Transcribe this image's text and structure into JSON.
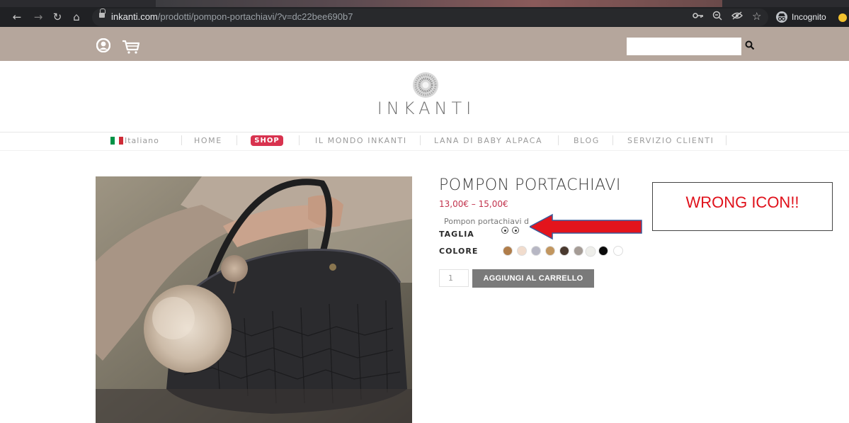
{
  "browser": {
    "url_domain": "inkanti.com",
    "url_path": "/prodotti/pompon-portachiavi/?v=dc22bee690b7",
    "profile_label": "Incognito",
    "icons": [
      "back-icon",
      "forward-icon",
      "reload-icon",
      "home-icon",
      "lock-icon",
      "key-icon",
      "zoom-icon",
      "eye-off-icon",
      "star-icon",
      "incognito-icon"
    ]
  },
  "site_header": {
    "icons": [
      "user-icon",
      "cart-icon",
      "search-icon"
    ],
    "search_value": ""
  },
  "logo": {
    "text": "INKANTI"
  },
  "menu": {
    "language": "Italiano",
    "items": [
      "HOME",
      "SHOP",
      "IL MONDO INKANTI",
      "LANA DI BABY ALPACA",
      "BLOG",
      "SERVIZIO CLIENTI"
    ],
    "active": "SHOP",
    "active_color": "#d8334f",
    "flag_colors": [
      "#009246",
      "#ffffff",
      "#ce2b37"
    ]
  },
  "product": {
    "title": "POMPON PORTACHIAVI",
    "price": "13,00€ – 15,00€",
    "description": "Pompon portachiavi d",
    "size_label": "TAGLIA",
    "size_options": 2,
    "color_label": "COLORE",
    "swatches": [
      "#b07d4a",
      "#f1dccd",
      "#b7b7c4",
      "#c2965f",
      "#4a3a2f",
      "#eeeeea",
      "#a59c96",
      "#0a0a0a"
    ],
    "quantity": "1",
    "add_to_cart": "AGGIUNGI AL CARRELLO"
  },
  "annotation": {
    "text": "WRONG ICON!!",
    "color": "#e0101a"
  }
}
